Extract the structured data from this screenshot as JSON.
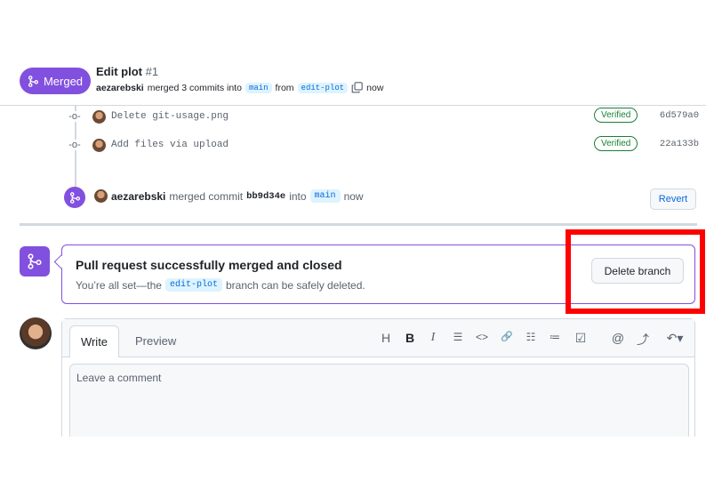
{
  "header": {
    "badge_label": "Merged",
    "title": "Edit plot",
    "number": "#1",
    "author": "aezarebski",
    "meta_text": "merged 3 commits into",
    "base_branch": "main",
    "from_text": "from",
    "head_branch": "edit-plot",
    "time": "now"
  },
  "commits": [
    {
      "message": "Delete git-usage.png",
      "verified": "Verified",
      "sha": "6d579a0"
    },
    {
      "message": "Add files via upload",
      "verified": "Verified",
      "sha": "22a133b"
    }
  ],
  "merge_event": {
    "author": "aezarebski",
    "text": "merged commit",
    "commit": "bb9d34e",
    "into": "into",
    "branch": "main",
    "time": "now",
    "revert_label": "Revert"
  },
  "merged_box": {
    "title": "Pull request successfully merged and closed",
    "sub_prefix": "You’re all set—the",
    "branch": "edit-plot",
    "sub_suffix": "branch can be safely deleted.",
    "delete_label": "Delete branch"
  },
  "editor": {
    "tab_write": "Write",
    "tab_preview": "Preview",
    "placeholder": "Leave a comment",
    "toolbar": {
      "heading": "H",
      "bold": "B",
      "italic": "I",
      "quote": "☰",
      "code": "<>",
      "link": "🔗",
      "ul": "☷",
      "ol": "≔",
      "task": "☑",
      "mention": "@",
      "ref": "⤴",
      "reply": "↶▾"
    }
  },
  "colors": {
    "accent": "#8250df",
    "link": "#0969da",
    "verified": "#1a7f37",
    "highlight": "#ff0000"
  }
}
